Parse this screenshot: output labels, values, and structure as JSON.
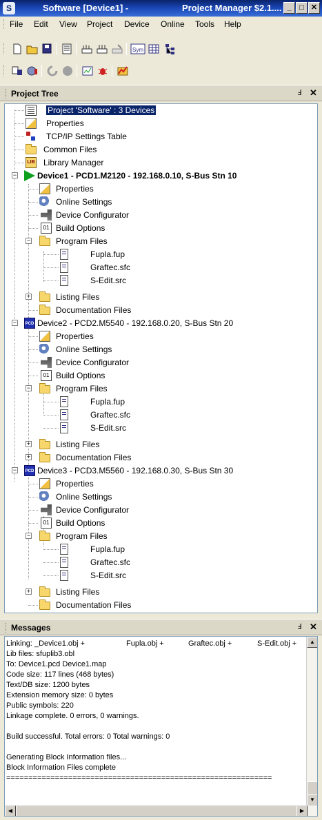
{
  "window": {
    "title_left": "Software [Device1] -",
    "title_right": "Project Manager $2.1....",
    "app_icon": "saia-logo-icon",
    "btn_min": "_",
    "btn_max": "□",
    "btn_close": "✕"
  },
  "menu": [
    "File",
    "Edit",
    "View",
    "Project",
    "Device",
    "Online",
    "Tools",
    "Help"
  ],
  "panels": {
    "tree_title": "Project Tree",
    "messages_title": "Messages",
    "pin": "Ⅎ",
    "close": "✕"
  },
  "tree": {
    "project": "Project 'Software' : 3 Devices",
    "properties": "Properties",
    "tcpip": "TCP/IP Settings Table",
    "common": "Common Files",
    "library": "Library Manager",
    "devices": [
      {
        "label": "Device1 - PCD1.M2120 - 192.168.0.10, S-Bus Stn 10",
        "properties": "Properties",
        "online": "Online Settings",
        "configurator": "Device Configurator",
        "build": "Build Options",
        "program": "Program Files",
        "files": [
          "Fupla.fup",
          "Graftec.sfc",
          "S-Edit.src"
        ],
        "listing": "Listing Files",
        "documentation": "Documentation Files"
      },
      {
        "label": "Device2 - PCD2.M5540 - 192.168.0.20, S-Bus Stn 20",
        "properties": "Properties",
        "online": "Online Settings",
        "configurator": "Device Configurator",
        "build": "Build Options",
        "program": "Program Files",
        "files": [
          "Fupla.fup",
          "Graftec.sfc",
          "S-Edit.src"
        ],
        "listing": "Listing Files",
        "documentation": "Documentation Files"
      },
      {
        "label": "Device3 - PCD3.M5560 - 192.168.0.30, S-Bus Stn 30",
        "properties": "Properties",
        "online": "Online Settings",
        "configurator": "Device Configurator",
        "build": "Build Options",
        "program": "Program Files",
        "files": [
          "Fupla.fup",
          "Graftec.sfc",
          "S-Edit.src"
        ],
        "listing": "Listing Files",
        "documentation": "Documentation Files"
      }
    ]
  },
  "messages": {
    "linking": "Linking: _Device1.obj +",
    "link_fupla": "Fupla.obj +",
    "link_graftec": "Graftec.obj +",
    "link_sedit": "S-Edit.obj +",
    "lines": [
      "Lib files: sfuplib3.obl",
      "To: Device1.pcd Device1.map",
      "Code size: 117 lines (468 bytes)",
      "Text/DB size: 1200 bytes",
      "Extension memory size: 0 bytes",
      "Public symbols: 220",
      "Linkage complete. 0 errors, 0 warnings.",
      "",
      "Build successful.  Total errors: 0  Total warnings: 0",
      "",
      "Generating Block Information files...",
      "Block Information Files complete",
      "============================================================"
    ]
  },
  "toolbar_icons": {
    "row1": [
      "new-file-icon",
      "open-folder-icon",
      "save-all-icon",
      "properties-icon",
      "build-icon",
      "rebuild-icon",
      "clean-icon",
      "symbol-editor-icon",
      "table-icon",
      "tree-icon"
    ],
    "row2": [
      "download-icon",
      "online-config-icon",
      "run-icon",
      "stop-icon",
      "debug-icon",
      "bug-icon",
      "diagnostics-icon"
    ]
  }
}
